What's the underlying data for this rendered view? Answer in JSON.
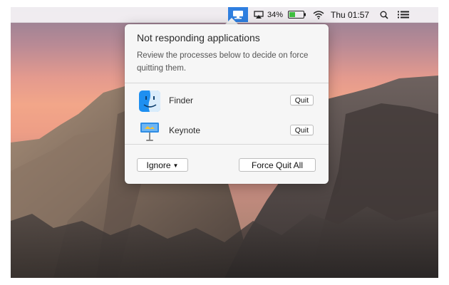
{
  "menubar": {
    "battery_percent": "34%",
    "clock": "Thu 01:57",
    "icons": [
      "not-responding-app-icon",
      "airplay-icon",
      "battery-icon",
      "wifi-icon",
      "spotlight-search-icon",
      "notification-center-icon"
    ]
  },
  "popover": {
    "title": "Not responding applications",
    "description": "Review the processes below to decide on force quitting them.",
    "apps": [
      {
        "name": "Finder",
        "quit_label": "Quit",
        "icon": "finder-icon"
      },
      {
        "name": "Keynote",
        "quit_label": "Quit",
        "icon": "keynote-icon"
      }
    ],
    "ignore_label": "Ignore",
    "force_quit_all_label": "Force Quit All"
  },
  "colors": {
    "accent": "#2f7fe0",
    "popover_bg": "#f6f6f6"
  }
}
